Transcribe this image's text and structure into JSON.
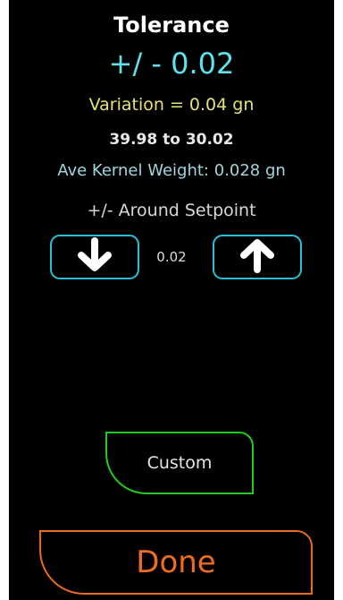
{
  "header": {
    "title": "Tolerance",
    "tolerance_display": "+/ - 0.02"
  },
  "info": {
    "variation": "Variation = 0.04 gn",
    "range": "39.98 to 30.02",
    "kernel_weight": "Ave Kernel Weight: 0.028 gn",
    "around_setpoint": "+/- Around Setpoint"
  },
  "stepper": {
    "value": "0.02",
    "down_icon": "arrow-down-icon",
    "up_icon": "arrow-up-icon"
  },
  "buttons": {
    "custom_label": "Custom",
    "done_label": "Done"
  },
  "colors": {
    "background": "#000000",
    "tolerance_value": "#5fe3ea",
    "variation_text": "#e6e27a",
    "stepper_border": "#2bbfd6",
    "custom_border": "#22cc22",
    "done_accent": "#e96a1e"
  }
}
